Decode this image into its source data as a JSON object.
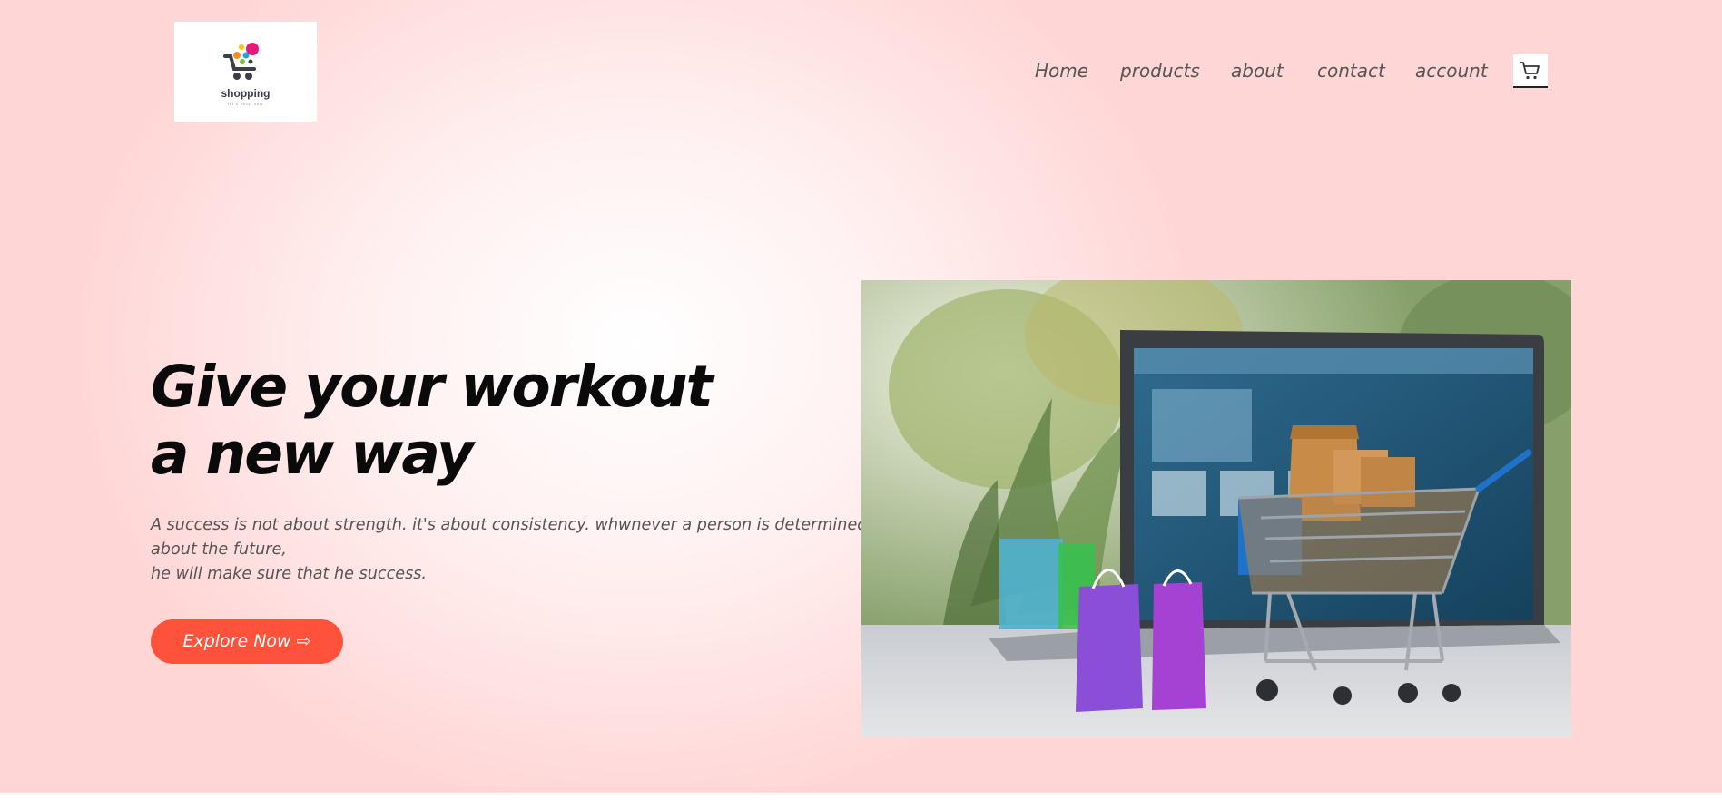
{
  "logo": {
    "name": "shopping",
    "tagline": "let's shop now"
  },
  "nav": {
    "items": [
      {
        "label": "Home"
      },
      {
        "label": "products"
      },
      {
        "label": "about"
      },
      {
        "label": "contact"
      },
      {
        "label": "account"
      }
    ],
    "cart_icon": "cart-icon"
  },
  "hero": {
    "headline_line1": "Give your workout",
    "headline_line2": "a new way",
    "description_line1": "A success is not about strength. it's about consistency. whwnever a person is determined about the future,",
    "description_line2": "he will make sure that he success.",
    "button_label": "Explore Now ⇨",
    "image_icon": "shopping-cart-laptop-photo"
  },
  "colors": {
    "accent": "#ff523b",
    "background_pink": "#ffd6d6",
    "text_dark": "#0a0a0a",
    "text_muted": "#555555"
  }
}
